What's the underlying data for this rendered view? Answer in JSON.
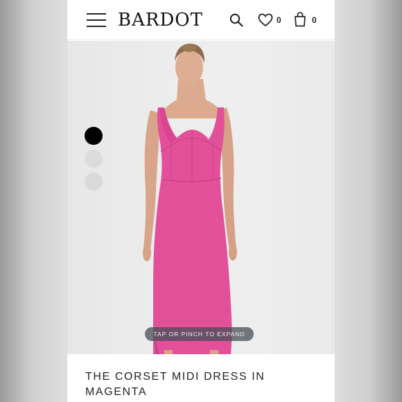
{
  "header": {
    "brand": "BARDOT",
    "wishlist_count": "0",
    "bag_count": "0"
  },
  "icons": [
    "hamburger-menu-icon",
    "search-icon",
    "heart-icon",
    "bag-icon"
  ],
  "gallery": {
    "expand_hint": "TAP OR PINCH TO EXPAND",
    "swatches": [
      {
        "name": "black",
        "color": "#000000"
      },
      {
        "name": "grey",
        "color": "#dcdcdc"
      },
      {
        "name": "grey",
        "color": "#dadada"
      }
    ]
  },
  "product": {
    "title": "THE CORSET MIDI DRESS IN MAGENTA",
    "color": "#e2509a"
  }
}
